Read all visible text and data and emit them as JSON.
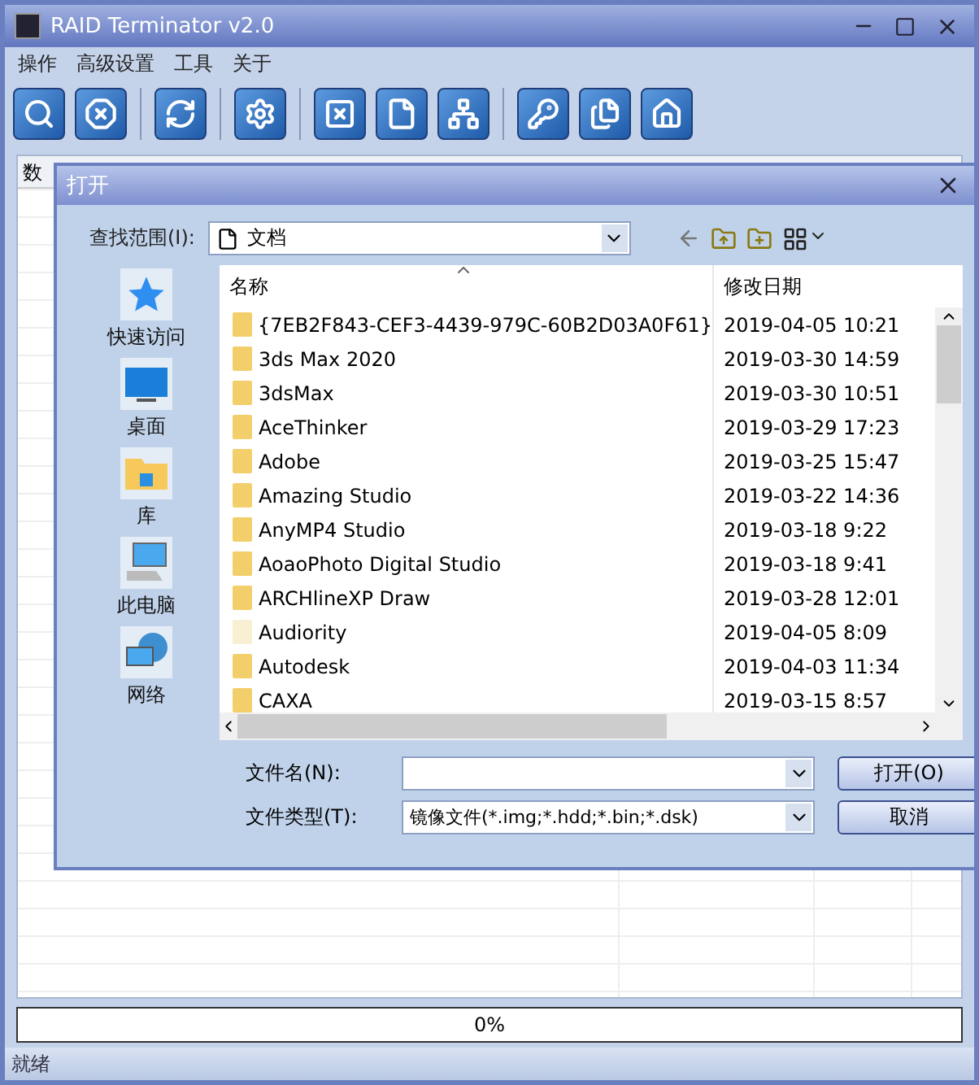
{
  "window": {
    "title": "RAID Terminator v2.0"
  },
  "menu": [
    "操作",
    "高级设置",
    "工具",
    "关于"
  ],
  "table": {
    "columns": [
      "数"
    ]
  },
  "progress": {
    "level": 0,
    "reading": "0%"
  },
  "status_bar": "就绪",
  "dialog": {
    "title": "打开",
    "look_in": {
      "label": "查找范围(I):",
      "value": "文档"
    },
    "places": [
      {
        "kind": "star",
        "label": "快速访问"
      },
      {
        "kind": "desktop",
        "label": "桌面"
      },
      {
        "kind": "library",
        "label": "库"
      },
      {
        "kind": "computer",
        "label": "此电脑"
      },
      {
        "kind": "network",
        "label": "网络"
      }
    ],
    "columns": [
      "名称",
      "修改日期"
    ],
    "files": [
      {
        "name": "{7EB2F843-CEF3-4439-979C-60B2D03A0F61}",
        "modified": "2019-04-05 10:21",
        "hidden": false
      },
      {
        "name": "3ds Max 2020",
        "modified": "2019-03-30 14:59",
        "hidden": false
      },
      {
        "name": "3dsMax",
        "modified": "2019-03-30 10:51",
        "hidden": false
      },
      {
        "name": "AceThinker",
        "modified": "2019-03-29 17:23",
        "hidden": false
      },
      {
        "name": "Adobe",
        "modified": "2019-03-25 15:47",
        "hidden": false
      },
      {
        "name": "Amazing Studio",
        "modified": "2019-03-22 14:36",
        "hidden": false
      },
      {
        "name": "AnyMP4 Studio",
        "modified": "2019-03-18 9:22",
        "hidden": false
      },
      {
        "name": "AoaoPhoto Digital Studio",
        "modified": "2019-03-18 9:41",
        "hidden": false
      },
      {
        "name": "ARCHlineXP Draw",
        "modified": "2019-03-28 12:01",
        "hidden": false
      },
      {
        "name": "Audiority",
        "modified": "2019-04-05 8:09",
        "hidden": true
      },
      {
        "name": "Autodesk",
        "modified": "2019-04-03 11:34",
        "hidden": false
      },
      {
        "name": "CAXA",
        "modified": "2019-03-15 8:57",
        "hidden": false
      }
    ],
    "file_name": {
      "label": "文件名(N):"
    },
    "file_type": {
      "label": "文件类型(T):",
      "value": "镜像文件(*.img;*.hdd;*.bin;*.dsk)"
    },
    "buttons": [
      "打开(O)",
      "取消"
    ]
  }
}
